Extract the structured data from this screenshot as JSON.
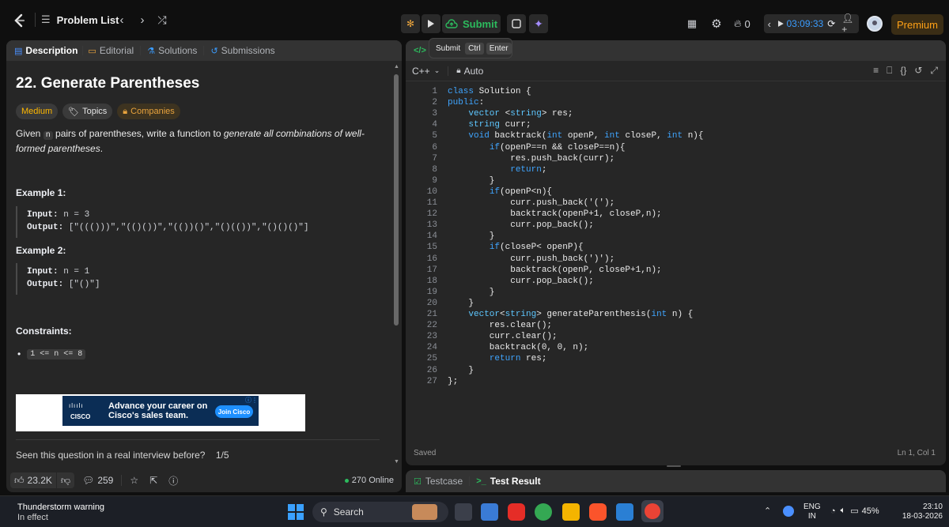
{
  "topbar": {
    "problem_list": "Problem List",
    "submit": "Submit",
    "streak": "0",
    "timer": "03:09:33",
    "premium": "Premium"
  },
  "tooltip": {
    "label": "Submit",
    "key1": "Ctrl",
    "key2": "Enter"
  },
  "left_tabs": [
    {
      "label": "Description"
    },
    {
      "label": "Editorial"
    },
    {
      "label": "Solutions"
    },
    {
      "label": "Submissions"
    }
  ],
  "problem": {
    "title": "22. Generate Parentheses",
    "difficulty": "Medium",
    "topics": "Topics",
    "companies": "Companies",
    "desc_pre": "Given ",
    "desc_code": "n",
    "desc_mid": " pairs of parentheses, write a function to ",
    "desc_em": "generate all combinations of well-formed parentheses",
    "desc_end": ".",
    "ex1_title": "Example 1:",
    "ex1_input_label": "Input:",
    "ex1_input": "n = 3",
    "ex1_output_label": "Output:",
    "ex1_output": "[\"((()))\",\"(()())\",\"(())()\",\"()(())\",\"()()()\"]",
    "ex2_title": "Example 2:",
    "ex2_input_label": "Input:",
    "ex2_input": "n = 1",
    "ex2_output_label": "Output:",
    "ex2_output": "[\"()\"]",
    "constraints_title": "Constraints:",
    "constraint": "1 <= n <= 8",
    "ad_text1": "Advance your career on",
    "ad_text2": "Cisco's sales team.",
    "ad_button": "Join Cisco",
    "ad_brand": "CISCO",
    "seen": "Seen this question in a real interview before?",
    "seen_count": "1/5"
  },
  "left_footer": {
    "likes": "23.2K",
    "comments": "259",
    "online": "270 Online"
  },
  "editor": {
    "language": "C++",
    "mode": "Auto",
    "status": "Saved",
    "cursor": "Ln 1, Col 1",
    "lines": [
      "class Solution {",
      "public:",
      "    vector <string> res;",
      "    string curr;",
      "    void backtrack(int openP, int closeP, int n){",
      "        if(openP==n && closeP==n){",
      "            res.push_back(curr);",
      "            return;",
      "        }",
      "        if(openP<n){",
      "            curr.push_back('(');",
      "            backtrack(openP+1, closeP,n);",
      "            curr.pop_back();",
      "        }",
      "        if(closeP< openP){",
      "            curr.push_back(')');",
      "            backtrack(openP, closeP+1,n);",
      "            curr.pop_back();",
      "        }",
      "    }",
      "    vector<string> generateParenthesis(int n) {",
      "        res.clear();",
      "        curr.clear();",
      "        backtrack(0, 0, n);",
      "        return res;",
      "    }",
      "};"
    ]
  },
  "bottom_tabs": {
    "testcase": "Testcase",
    "result": "Test Result"
  },
  "taskbar": {
    "weather_title": "Thunderstorm warning",
    "weather_sub": "In effect",
    "search": "Search",
    "lang1": "ENG",
    "lang2": "IN",
    "battery": "45%",
    "time": "23:10",
    "date": "18-03-2026"
  }
}
